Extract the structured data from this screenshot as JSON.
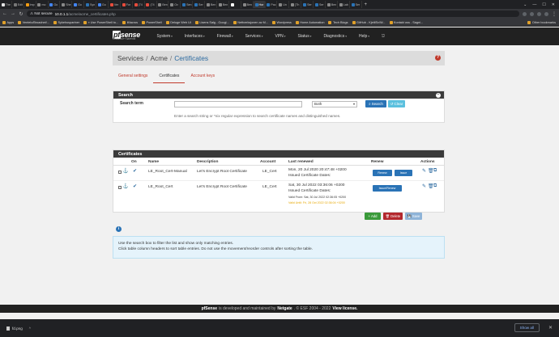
{
  "browser": {
    "tabs": [
      {
        "label": "The",
        "color": "#e4e4e4"
      },
      {
        "label": "Edit",
        "color": "#777"
      },
      {
        "label": "Imp",
        "color": "#f39c12"
      },
      {
        "label": "mo",
        "color": "#888"
      },
      {
        "label": "Go",
        "color": "#4285f4"
      },
      {
        "label": "She",
        "color": "#888"
      },
      {
        "label": "Go",
        "color": "#4285f4"
      },
      {
        "label": "Syn",
        "color": "#2a73b6"
      },
      {
        "label": "Go",
        "color": "#4285f4"
      },
      {
        "label": "Ver",
        "color": "#e74c3c"
      },
      {
        "label": "For",
        "color": "#e74c3c"
      },
      {
        "label": "(74",
        "color": "#e74c3c"
      },
      {
        "label": "(74",
        "color": "#e74c3c"
      },
      {
        "label": "Ben",
        "color": "#888"
      },
      {
        "label": "Ov",
        "color": "#888"
      },
      {
        "label": "Sen",
        "color": "#2a73b6"
      },
      {
        "label": "Ser",
        "color": "#2a73b6"
      },
      {
        "label": "Ben",
        "color": "#888"
      },
      {
        "label": "Ben",
        "color": "#888"
      },
      {
        "label": "",
        "color": "#fff"
      },
      {
        "label": "Ben",
        "color": "#888"
      },
      {
        "label": "Hor",
        "color": "#2a73b6",
        "active": true
      },
      {
        "label": "Pac",
        "color": "#2a73b6"
      },
      {
        "label": "Un",
        "color": "#888"
      },
      {
        "label": "[Th",
        "color": "#888"
      },
      {
        "label": "Ser",
        "color": "#2a73b6"
      },
      {
        "label": "Ser",
        "color": "#2a73b6"
      },
      {
        "label": "Ben",
        "color": "#888"
      },
      {
        "label": "Lab",
        "color": "#888"
      },
      {
        "label": "Ser",
        "color": "#2a73b6"
      }
    ],
    "new_tab": "+",
    "window_controls": [
      "⌄",
      "—",
      "☐",
      "✕"
    ],
    "nav": {
      "back": "←",
      "forward": "→",
      "reload": "↻"
    },
    "security_label": "⚠ Not secure",
    "url_host": "10.0.1.1",
    "url_path": "/acme/acme_certificates.php",
    "bookmarks": [
      "Apps",
      "Ventelo/Broadnet/...",
      "Sykehuspartner",
      "» Use PowerShell to...",
      "iMacros",
      "PowerShell",
      "Deluge Web UI",
      "Lisens Salg - Googl...",
      "Nettverksjonen av M...",
      "Wordpress",
      "Home Automation",
      "Tech Blogs",
      "GitHub - KjetilSv/W...",
      "Kontakt oss - Sagni..."
    ],
    "other_bookmarks": "Other bookmarks"
  },
  "nav": {
    "logo_text": "sense",
    "logo_prefix": "pf",
    "logo_sub": "COMMUNITY EDITION",
    "menu": [
      "System",
      "Interfaces",
      "Firewall",
      "Services",
      "VPN",
      "Status",
      "Diagnostics",
      "Help"
    ],
    "logout_icon": "⎋"
  },
  "breadcrumb": {
    "part1": "Services",
    "part2": "Acme",
    "current": "Certificates",
    "help": "?"
  },
  "subtabs": [
    "General settings",
    "Certificates",
    "Account keys"
  ],
  "search": {
    "title": "Search",
    "label": "Search term",
    "input_value": "",
    "select_value": "Both",
    "search_btn": "Search",
    "clear_btn": "Clear",
    "help": "Enter a search string or *nix regular expression to search certificate names and distinguished names."
  },
  "certificates": {
    "title": "Certificates",
    "headers": [
      "On",
      "Name",
      "Description",
      "Account",
      "Last renewed",
      "Renew",
      "Actions"
    ],
    "rows": [
      {
        "name": "LE_Root_Cert-Manual",
        "description": "Let's Encrypt Root Certificate",
        "account": "LE_Cert",
        "renewed_line1": "Mon, 20 Jul 2020 20:47:48 +0200",
        "renewed_line2": "Issued Certificate Dates:",
        "renew_btn1": "Renew",
        "renew_btn2": "Issue"
      },
      {
        "name": "LE_Root_Cert",
        "description": "Let's Encrypt Root Certificate",
        "account": "LE_Cert",
        "renewed_line1": "Sat, 30 Jul 2022 03:36:06 +0200",
        "renewed_line2": "Issued Certificate Dates:",
        "valid_from": "Valid From: Sat, 30 Jul 2022 02:36:05 +0200",
        "valid_until": "Valid Until: Fri, 28 Oct 2022 02:36:04 +0200",
        "renew_btn1": "Issue/Renew"
      }
    ]
  },
  "actions": {
    "add": "Add",
    "delete": "Delete",
    "save": "Save"
  },
  "info": {
    "line1": "Use the search box to filter the list and show only matching entries.",
    "line2": "Click table column headers to sort table entries. Do not use the movement/reorder controls after sorting the table."
  },
  "footer": {
    "brand": "pfSense",
    "mid": "is developed and maintained by",
    "company": "Netgate",
    "copy": ". © ESF 2004 - 2022",
    "license": "View license."
  },
  "downloads": {
    "file": "fd.png",
    "more": "^",
    "show_all": "Show all",
    "close": "✕"
  }
}
